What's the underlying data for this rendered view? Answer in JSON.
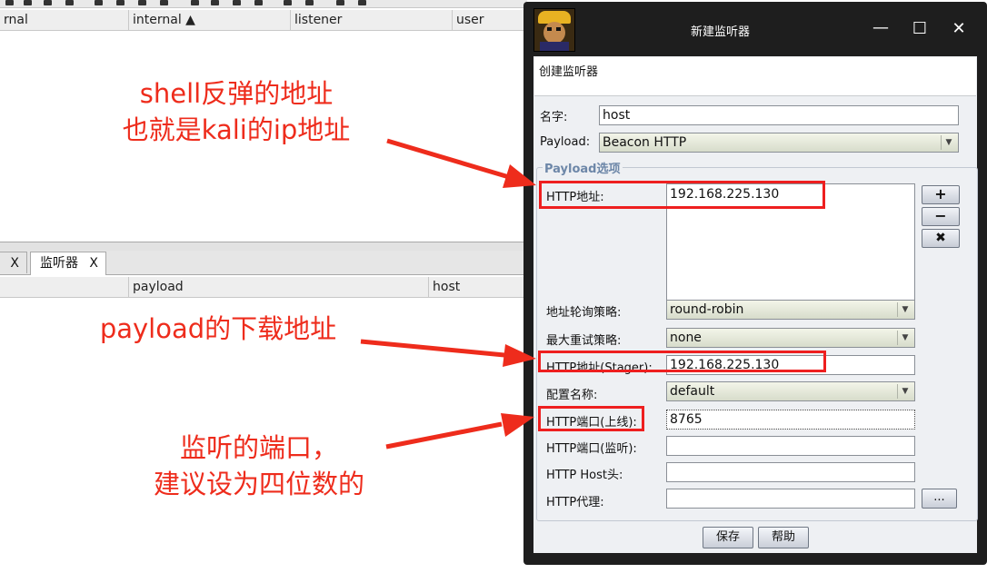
{
  "background": {
    "top_table_columns": [
      "rnal",
      "internal ▲",
      "listener",
      "user"
    ],
    "tabs": [
      {
        "label": "",
        "close": "X"
      },
      {
        "label": "监听器",
        "close": "X"
      }
    ],
    "bottom_table_columns": [
      "",
      "payload",
      "host"
    ]
  },
  "annotations": {
    "a1_line1": "shell反弹的地址",
    "a1_line2": "也就是kali的ip地址",
    "a2": "payload的下载地址",
    "a3_line1": "监听的端口，",
    "a3_line2": "建议设为四位数的",
    "color": "#ee2c1c"
  },
  "dialog": {
    "title": "新建监听器",
    "minimize": "—",
    "maximize": "☐",
    "close": "✕",
    "description": "创建监听器",
    "name_label": "名字:",
    "name_value": "host",
    "payload_label": "Payload:",
    "payload_value": "Beacon HTTP",
    "group_title": "Payload选项",
    "http_hosts_label": "HTTP地址:",
    "http_hosts_value": "192.168.225.130",
    "add_button": "+",
    "remove_button": "−",
    "clear_button": "✖",
    "rotation_label": "地址轮询策略:",
    "rotation_value": "round-robin",
    "max_retry_label": "最大重试策略:",
    "max_retry_value": "none",
    "stager_label": "HTTP地址(Stager):",
    "stager_value": "192.168.225.130",
    "profile_label": "配置名称:",
    "profile_value": "default",
    "port_c2_label": "HTTP端口(上线):",
    "port_c2_value": "8765",
    "port_bind_label": "HTTP端口(监听):",
    "port_bind_value": "",
    "host_header_label": "HTTP Host头:",
    "host_header_value": "",
    "proxy_label": "HTTP代理:",
    "proxy_value": "",
    "proxy_button": "...",
    "save_button": "保存",
    "help_button": "帮助",
    "highlight_color": "#ee1f1f"
  }
}
